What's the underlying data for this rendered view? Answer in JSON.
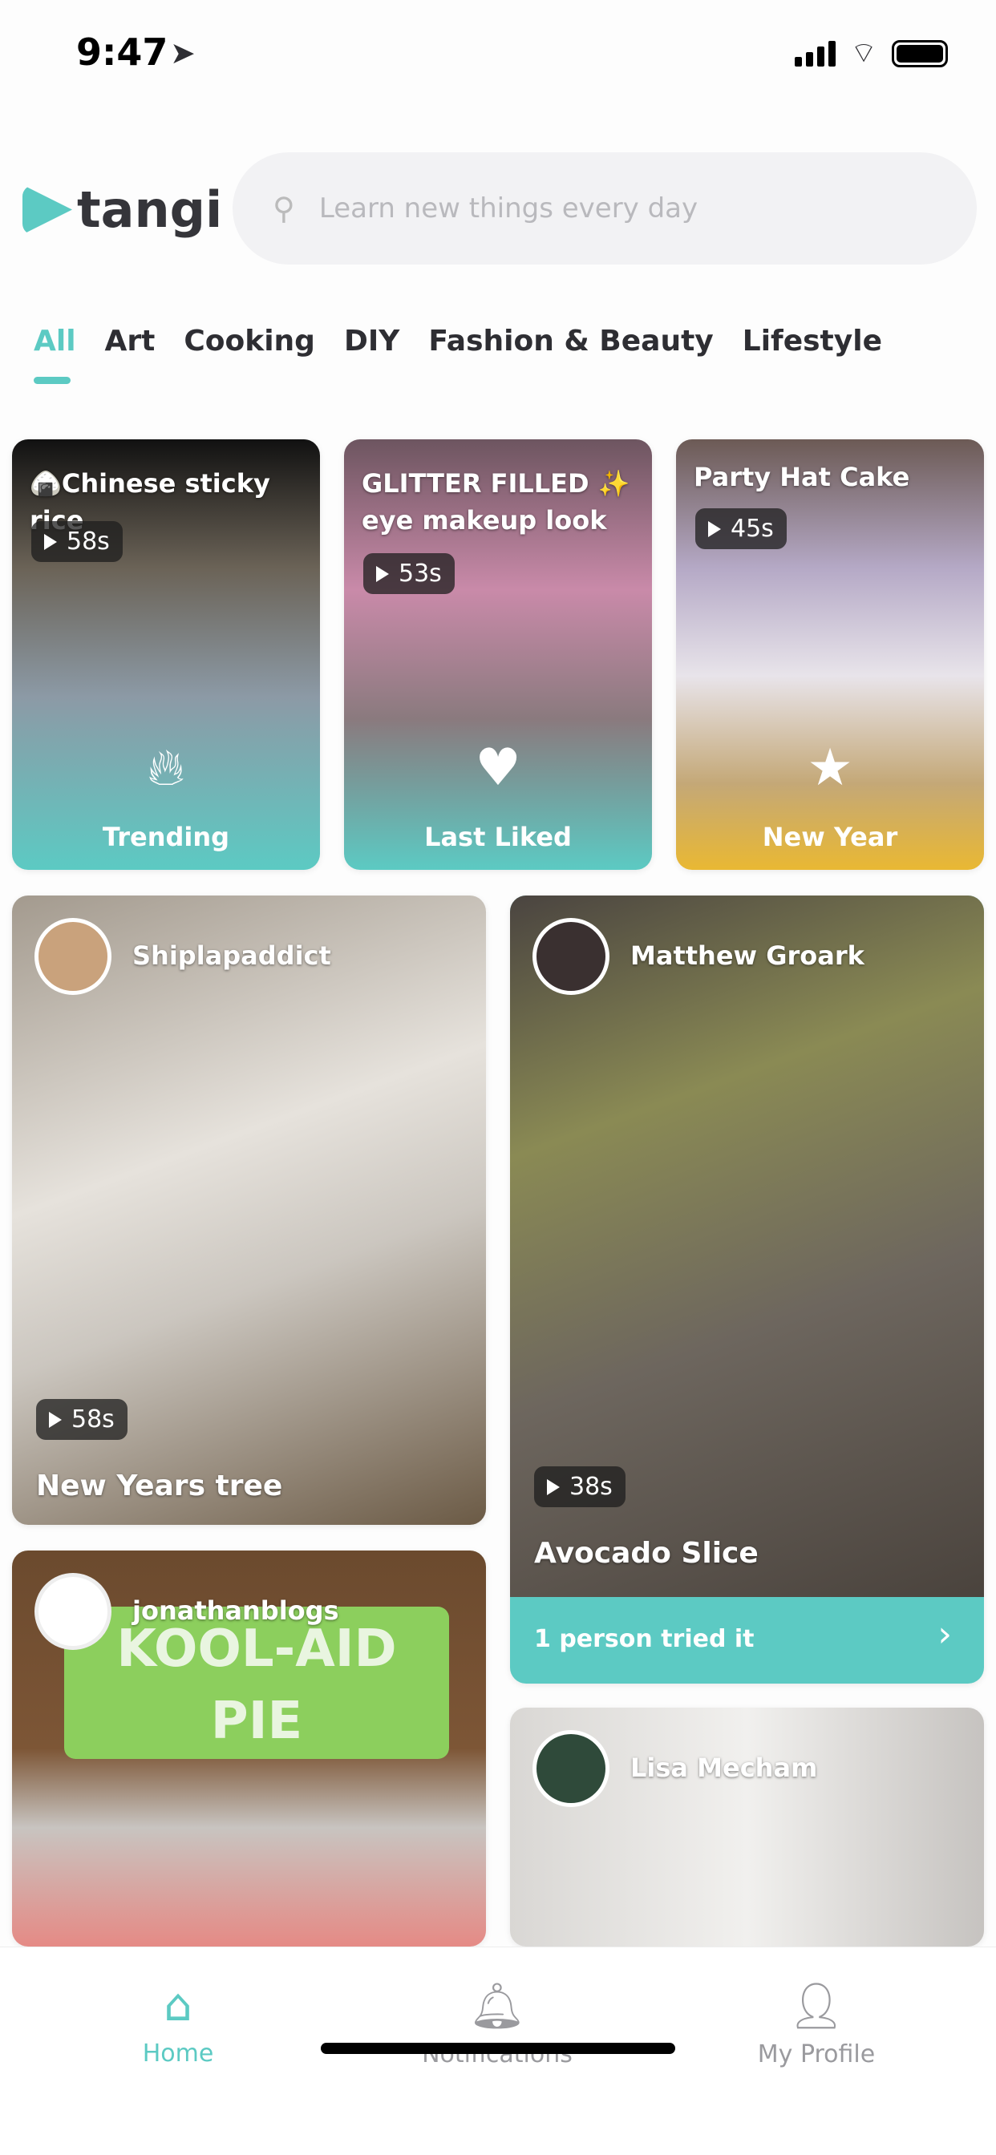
{
  "status": {
    "time": "9:47"
  },
  "header": {
    "logo": "tangi",
    "search_placeholder": "Learn new things every day"
  },
  "tabs": [
    {
      "label": "All",
      "active": true
    },
    {
      "label": "Art"
    },
    {
      "label": "Cooking"
    },
    {
      "label": "DIY"
    },
    {
      "label": "Fashion & Beauty"
    },
    {
      "label": "Lifestyle"
    }
  ],
  "featured": [
    {
      "title": "🍙Chinese sticky rice",
      "duration": "58s",
      "category": "Trending",
      "icon": "fire-icon"
    },
    {
      "title": "GLITTER FILLED ✨ eye makeup look",
      "duration": "53s",
      "category": "Last Liked",
      "icon": "heart-icon"
    },
    {
      "title": "Party Hat Cake",
      "duration": "45s",
      "category": "New Year",
      "icon": "star-icon"
    }
  ],
  "feed": [
    {
      "author": "Shiplapaddict",
      "title": "New Years tree",
      "duration": "58s"
    },
    {
      "author": "Matthew Groark",
      "title": "Avocado Slice",
      "duration": "38s",
      "tried": "1 person tried it"
    },
    {
      "author": "jonathanblogs",
      "image_text": "KOOL-AID PIE"
    },
    {
      "author": "Lisa Mecham"
    }
  ],
  "nav": [
    {
      "label": "Home",
      "active": true
    },
    {
      "label": "Notifications"
    },
    {
      "label": "My Profile"
    }
  ],
  "colors": {
    "accent": "#5ccac3",
    "new_year": "#e9b833"
  }
}
